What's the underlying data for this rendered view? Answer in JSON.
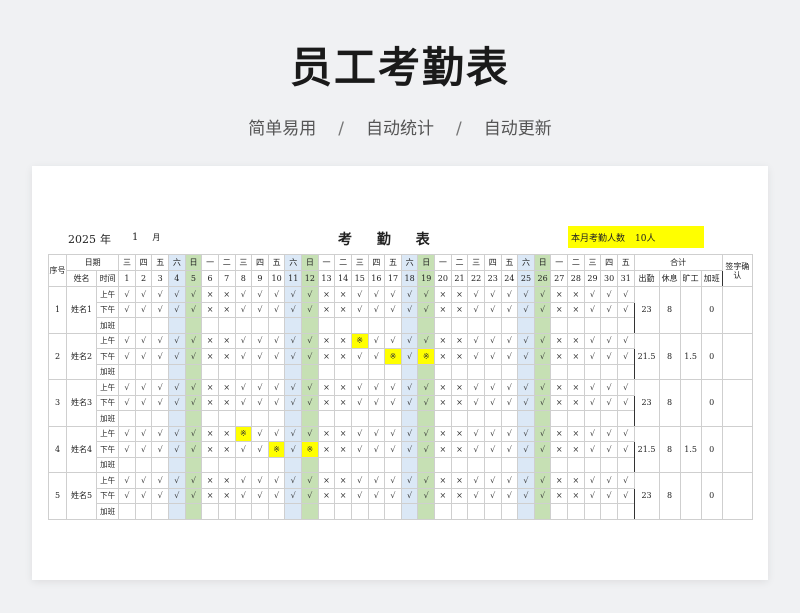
{
  "hero": {
    "title": "员工考勤表",
    "tags": [
      "简单易用",
      "自动统计",
      "自动更新"
    ],
    "separator": "/"
  },
  "sheet": {
    "year": "2025",
    "year_unit": "年",
    "month": "1",
    "month_unit": "月",
    "title": "考 勤 表",
    "count_label": "本月考勤人数",
    "count_value": "10人"
  },
  "table": {
    "headers": {
      "seq": "序号",
      "date": "日期",
      "name": "姓名",
      "time": "时间",
      "total": "合计",
      "sign": "签字确认",
      "totals": [
        "出勤",
        "休息",
        "旷工",
        "加班"
      ]
    },
    "weekdays": [
      "三",
      "四",
      "五",
      "六",
      "日",
      "一",
      "二",
      "三",
      "四",
      "五",
      "六",
      "日",
      "一",
      "二",
      "三",
      "四",
      "五",
      "六",
      "日",
      "一",
      "二",
      "三",
      "四",
      "五",
      "六",
      "日",
      "一",
      "二",
      "三",
      "四",
      "五"
    ],
    "days": [
      "1",
      "2",
      "3",
      "4",
      "5",
      "6",
      "7",
      "8",
      "9",
      "10",
      "11",
      "12",
      "13",
      "14",
      "15",
      "16",
      "17",
      "18",
      "19",
      "20",
      "21",
      "22",
      "23",
      "24",
      "25",
      "26",
      "27",
      "28",
      "29",
      "30",
      "31"
    ],
    "periods": [
      "上午",
      "下午",
      "加班"
    ],
    "employees": [
      {
        "seq": "1",
        "name": "姓名1",
        "am": "√√√√√××√√√√√××√√√√√××√√√√√××√√√",
        "pm": "√√√√√××√√√√√××√√√√√××√√√√√××√√√",
        "am_hl": [],
        "pm_hl": [],
        "attend": "23",
        "rest": "8",
        "absent": "",
        "overtime": "0"
      },
      {
        "seq": "2",
        "name": "姓名2",
        "am": "√√√√√××√√√√√××※√√√√××√√√√√××√√√",
        "pm": "√√√√√××√√√√√××√√※√※××√√√√√××√√√",
        "am_hl": [
          15
        ],
        "pm_hl": [
          17,
          19
        ],
        "attend": "21.5",
        "rest": "8",
        "absent": "1.5",
        "overtime": "0"
      },
      {
        "seq": "3",
        "name": "姓名3",
        "am": "√√√√√××√√√√√××√√√√√××√√√√√××√√√",
        "pm": "√√√√√××√√√√√××√√√√√××√√√√√××√√√",
        "am_hl": [],
        "pm_hl": [],
        "attend": "23",
        "rest": "8",
        "absent": "",
        "overtime": "0"
      },
      {
        "seq": "4",
        "name": "姓名4",
        "am": "√√√√√××※√√√√××√√√√√××√√√√√××√√√",
        "pm": "√√√√√××√√※√※××√√√√√××√√√√√××√√√",
        "am_hl": [
          8
        ],
        "pm_hl": [
          10,
          12
        ],
        "attend": "21.5",
        "rest": "8",
        "absent": "1.5",
        "overtime": "0"
      },
      {
        "seq": "5",
        "name": "姓名5",
        "am": "√√√√√××√√√√√××√√√√√××√√√√√××√√√",
        "pm": "√√√√√××√√√√√××√√√√√××√√√√√××√√√",
        "am_hl": [],
        "pm_hl": [],
        "attend": "23",
        "rest": "8",
        "absent": "",
        "overtime": "0"
      }
    ]
  },
  "colors": {
    "saturday": "#dbe8f6",
    "sunday": "#c6e0b4",
    "highlight": "#ffff00"
  }
}
